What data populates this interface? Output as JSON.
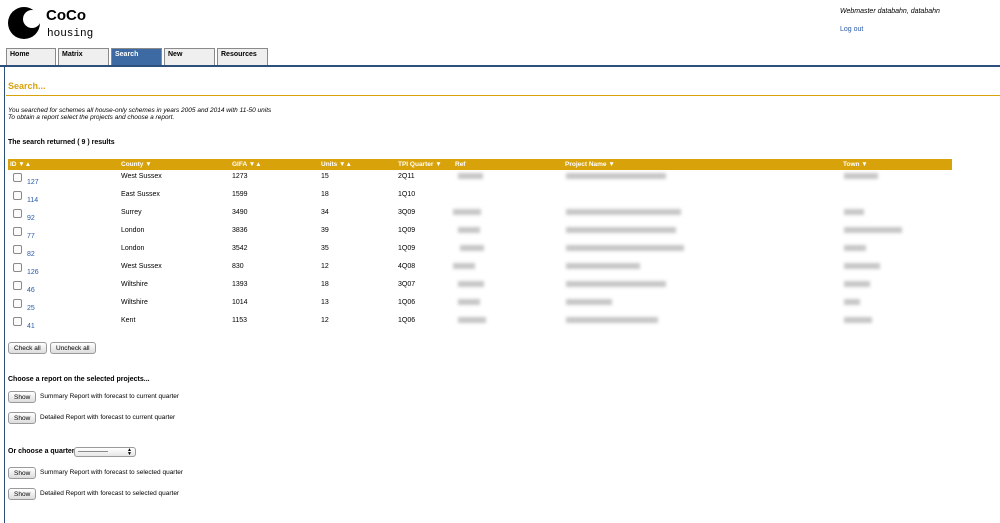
{
  "logo": {
    "line1": "CoCo",
    "line2": "housing"
  },
  "user": {
    "name": "Webmaster databahn, databahn",
    "logout": "Log out"
  },
  "tabs": [
    {
      "label": "Home",
      "active": false
    },
    {
      "label": "Matrix",
      "active": false
    },
    {
      "label": "Search",
      "active": true
    },
    {
      "label": "New",
      "active": false
    },
    {
      "label": "Resources",
      "active": false
    }
  ],
  "page": {
    "title": "Search...",
    "desc_line1": "You searched for schemes all house-only schemes in years 2005 and 2014 with 11-50 units",
    "desc_line2": "To obtain a report select the projects and choose a report.",
    "result_count": "The search returned ( 9 ) results"
  },
  "table": {
    "headers": {
      "id": "ID ▼▲",
      "county": "County ▼",
      "gifa": "GIFA ▼▲",
      "units": "Units ▼▲",
      "tpi": "TPI Quarter ▼",
      "ref": "Ref",
      "project": "Project Name ▼",
      "town": "Town ▼"
    },
    "rows": [
      {
        "id": "127",
        "county": "West Sussex",
        "gifa": "1273",
        "units": "15",
        "tpi": "2Q11"
      },
      {
        "id": "114",
        "county": "East Sussex",
        "gifa": "1599",
        "units": "18",
        "tpi": "1Q10"
      },
      {
        "id": "92",
        "county": "Surrey",
        "gifa": "3490",
        "units": "34",
        "tpi": "3Q09"
      },
      {
        "id": "77",
        "county": "London",
        "gifa": "3836",
        "units": "39",
        "tpi": "1Q09"
      },
      {
        "id": "82",
        "county": "London",
        "gifa": "3542",
        "units": "35",
        "tpi": "1Q09"
      },
      {
        "id": "126",
        "county": "West Sussex",
        "gifa": "830",
        "units": "12",
        "tpi": "4Q08"
      },
      {
        "id": "46",
        "county": "Wiltshire",
        "gifa": "1393",
        "units": "18",
        "tpi": "3Q07"
      },
      {
        "id": "25",
        "county": "Wiltshire",
        "gifa": "1014",
        "units": "13",
        "tpi": "1Q06"
      },
      {
        "id": "41",
        "county": "Kent",
        "gifa": "1153",
        "units": "12",
        "tpi": "1Q06"
      }
    ]
  },
  "buttons": {
    "check_all": "Check all",
    "uncheck_all": "Uncheck all",
    "show": "Show"
  },
  "reports": {
    "choose_label": "Choose a report on the selected projects...",
    "summary_current": "Summary Report with forecast to current quarter",
    "detailed_current": "Detailed Report with forecast to current quarter",
    "quarter_label": "Or choose a quarter",
    "quarter_value": "—————",
    "summary_selected": "Summary Report with forecast to selected quarter",
    "detailed_selected": "Detailed Report with forecast to selected quarter"
  },
  "colors": {
    "accent": "#d8a20a",
    "tab_active": "#3d6aa3",
    "link": "#2a5aa8"
  }
}
